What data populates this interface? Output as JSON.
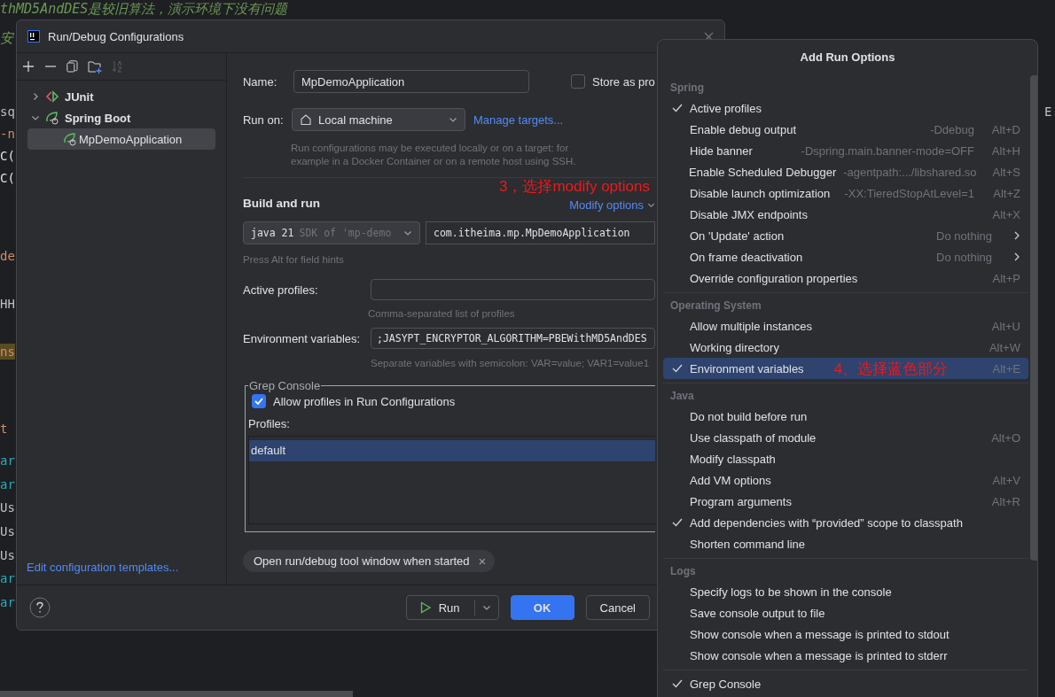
{
  "editor": {
    "comment": "thMD5AndDES是较旧算法，演示环境下没有问题",
    "comment2": "安",
    "fragments": [
      {
        "text": "sq",
        "kind": "plain"
      },
      {
        "text": "-n",
        "kind": "keyword"
      },
      {
        "text": "C(",
        "kind": "light"
      },
      {
        "text": "C(",
        "kind": "light"
      },
      {
        "text": "de",
        "kind": "keyword"
      },
      {
        "text": "HH",
        "kind": "plain"
      },
      {
        "text": "ns",
        "kind": "highlight"
      },
      {
        "text": "t",
        "kind": "keyword"
      },
      {
        "text": "ar",
        "kind": "teal"
      },
      {
        "text": "ar",
        "kind": "teal"
      },
      {
        "text": "Us",
        "kind": "plain"
      },
      {
        "text": "Us",
        "kind": "plain"
      },
      {
        "text": "Us",
        "kind": "plain"
      },
      {
        "text": "ar",
        "kind": "teal"
      },
      {
        "text": "ar",
        "kind": "teal"
      }
    ],
    "right_fragment": "E"
  },
  "dialog": {
    "title": "Run/Debug Configurations",
    "tree": [
      {
        "label": "JUnit",
        "kind": "junit",
        "expanded": false,
        "selected": false
      },
      {
        "label": "Spring Boot",
        "kind": "spring",
        "expanded": true,
        "selected": false,
        "children": [
          {
            "label": "MpDemoApplication",
            "kind": "spring",
            "selected": true
          }
        ]
      }
    ],
    "edit_templates_link": "Edit configuration templates...",
    "name_label": "Name:",
    "name_value": "MpDemoApplication",
    "store_checkbox": {
      "label": "Store as pro",
      "checked": false
    },
    "run_on_label": "Run on:",
    "run_on_value": "Local machine",
    "manage_targets": "Manage targets...",
    "run_on_hint": "Run configurations may be executed locally or on a target: for example in a Docker Container or on a remote host using SSH.",
    "annotation": "3，选择modify options",
    "build_heading": "Build and run",
    "modify_options": "Modify options",
    "jdk_value": "java 21",
    "jdk_hint": "SDK of 'mp-demo",
    "main_class": "com.itheima.mp.MpDemoApplication",
    "alt_hint": "Press Alt for field hints",
    "active_profiles_label": "Active profiles:",
    "active_profiles_hint": "Comma-separated list of profiles",
    "env_label": "Environment variables:",
    "env_value": ";JASYPT_ENCRYPTOR_ALGORITHM=PBEWithMD5AndDES",
    "env_hint": "Separate variables with semicolon: VAR=value; VAR1=value1",
    "grep": {
      "legend": "Grep Console",
      "allow": {
        "label": "Allow profiles in Run Configurations",
        "checked": true
      },
      "profiles_label": "Profiles:",
      "profiles": [
        {
          "label": "default",
          "selected": true
        }
      ]
    },
    "chip": "Open run/debug tool window when started",
    "chip_close": "×",
    "buttons": {
      "run": "Run",
      "ok": "OK",
      "cancel": "Cancel"
    }
  },
  "popup": {
    "title": "Add Run Options",
    "sections": [
      {
        "title": "Spring",
        "items": [
          {
            "label": "Active profiles",
            "kind": "item",
            "checked": true,
            "selected": false
          },
          {
            "label": "Enable debug output",
            "kind": "item",
            "checked": false,
            "selected": false,
            "hint": "-Ddebug",
            "shortcut": "Alt+D"
          },
          {
            "label": "Hide banner",
            "kind": "item",
            "checked": false,
            "selected": false,
            "hint": "-Dspring.main.banner-mode=OFF",
            "shortcut": "Alt+H"
          },
          {
            "label": "Enable Scheduled Debugger",
            "kind": "item",
            "checked": false,
            "selected": false,
            "hint": "-agentpath:.../libshared.so",
            "shortcut": "Alt+S"
          },
          {
            "label": "Disable launch optimization",
            "kind": "item",
            "checked": false,
            "selected": false,
            "hint": "-XX:TieredStopAtLevel=1",
            "shortcut": "Alt+Z"
          },
          {
            "label": "Disable JMX endpoints",
            "kind": "item",
            "checked": false,
            "selected": false,
            "shortcut": "Alt+X"
          },
          {
            "label": "On 'Update' action",
            "kind": "submenu",
            "checked": false,
            "selected": false,
            "hint": "Do nothing"
          },
          {
            "label": "On frame deactivation",
            "kind": "submenu",
            "checked": false,
            "selected": false,
            "hint": "Do nothing"
          },
          {
            "label": "Override configuration properties",
            "kind": "item",
            "checked": false,
            "selected": false,
            "shortcut": "Alt+P"
          }
        ]
      },
      {
        "title": "Operating System",
        "items": [
          {
            "label": "Allow multiple instances",
            "kind": "item",
            "checked": false,
            "selected": false,
            "shortcut": "Alt+U"
          },
          {
            "label": "Working directory",
            "kind": "item",
            "checked": false,
            "selected": false,
            "shortcut": "Alt+W"
          },
          {
            "label": "Environment variables",
            "kind": "item",
            "checked": true,
            "selected": true,
            "shortcut": "Alt+E",
            "annotation": "4、选择蓝色部分"
          }
        ]
      },
      {
        "title": "Java",
        "items": [
          {
            "label": "Do not build before run",
            "kind": "item",
            "checked": false,
            "selected": false
          },
          {
            "label": "Use classpath of module",
            "kind": "item",
            "checked": false,
            "selected": false,
            "shortcut": "Alt+O"
          },
          {
            "label": "Modify classpath",
            "kind": "item",
            "checked": false,
            "selected": false
          },
          {
            "label": "Add VM options",
            "kind": "item",
            "checked": false,
            "selected": false,
            "shortcut": "Alt+V"
          },
          {
            "label": "Program arguments",
            "kind": "item",
            "checked": false,
            "selected": false,
            "shortcut": "Alt+R"
          },
          {
            "label": "Add dependencies with “provided” scope to classpath",
            "kind": "item",
            "checked": true,
            "selected": false
          },
          {
            "label": "Shorten command line",
            "kind": "item",
            "checked": false,
            "selected": false
          }
        ]
      },
      {
        "title": "Logs",
        "items": [
          {
            "label": "Specify logs to be shown in the console",
            "kind": "item",
            "checked": false,
            "selected": false
          },
          {
            "label": "Save console output to file",
            "kind": "item",
            "checked": false,
            "selected": false
          },
          {
            "label": "Show console when a message is printed to stdout",
            "kind": "item",
            "checked": false,
            "selected": false
          },
          {
            "label": "Show console when a message is printed to stderr",
            "kind": "item",
            "checked": false,
            "selected": false
          }
        ]
      },
      {
        "items": [
          {
            "label": "Grep Console",
            "kind": "item",
            "checked": true,
            "selected": false
          }
        ]
      }
    ]
  }
}
